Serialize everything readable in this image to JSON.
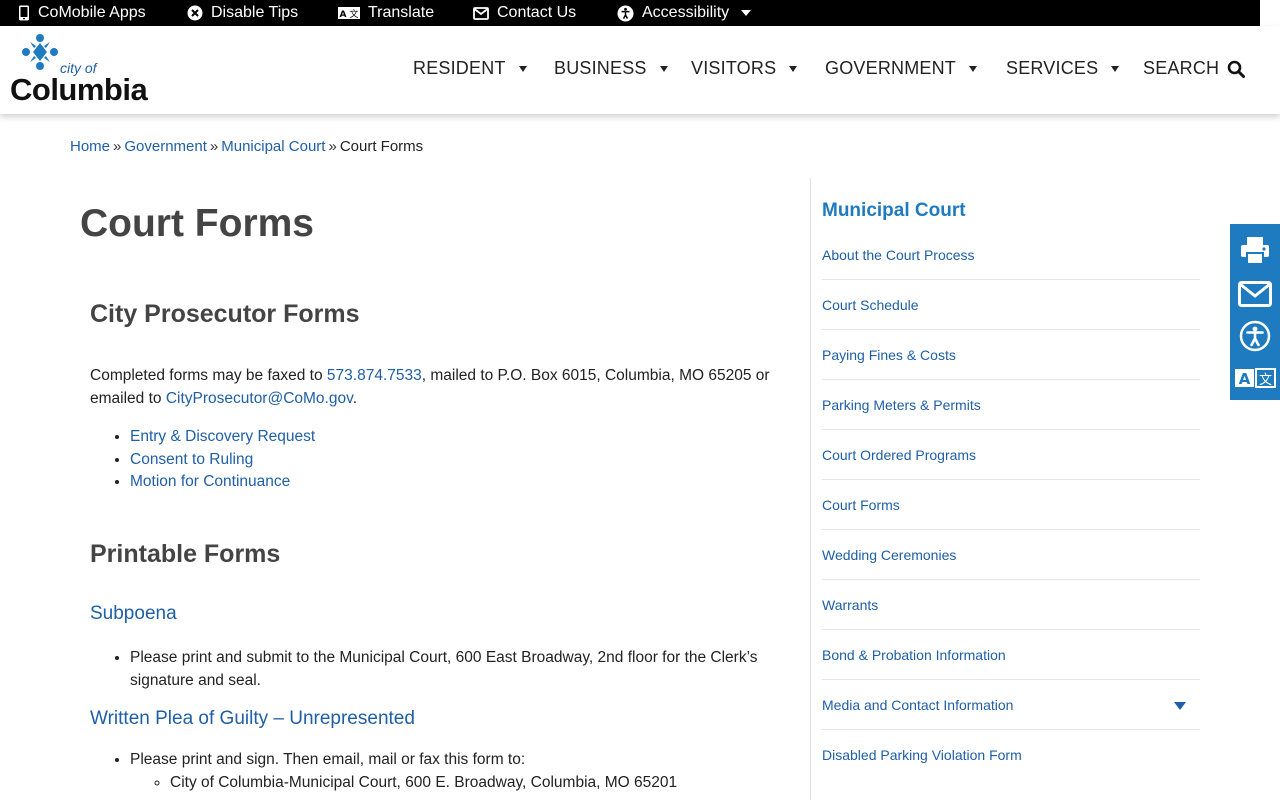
{
  "topbar": {
    "items": [
      {
        "label": "CoMobile Apps",
        "icon": "phone-icon"
      },
      {
        "label": "Disable Tips",
        "icon": "close-circle-icon"
      },
      {
        "label": "Translate",
        "icon": "translate-icon"
      },
      {
        "label": "Contact Us",
        "icon": "envelope-icon"
      },
      {
        "label": "Accessibility",
        "icon": "accessibility-icon"
      }
    ]
  },
  "logo": {
    "small": "city of",
    "name": "Columbia"
  },
  "nav": {
    "items": [
      {
        "label": "RESIDENT"
      },
      {
        "label": "BUSINESS"
      },
      {
        "label": "VISITORS"
      },
      {
        "label": "GOVERNMENT"
      },
      {
        "label": "SERVICES"
      }
    ],
    "search_label": "SEARCH"
  },
  "breadcrumb": {
    "home": "Home",
    "government": "Government",
    "court": "Municipal Court",
    "current": "Court Forms",
    "sep": "»"
  },
  "main": {
    "title": "Court Forms",
    "prosecutor": {
      "heading": "City Prosecutor Forms",
      "text_1": "Completed forms may be faxed to ",
      "fax": "573.874.7533",
      "text_2": ", mailed to P.O. Box 6015, Columbia, MO 65205 or emailed to ",
      "email": "CityProsecutor@CoMo.gov",
      "text_3": ".",
      "links": [
        "Entry & Discovery Request",
        "Consent to Ruling",
        "Motion for Continuance"
      ]
    },
    "printable": {
      "heading": "Printable Forms",
      "subpoena": {
        "heading": "Subpoena",
        "bullet": "Please print and submit to the Municipal Court, 600 East Broadway, 2nd floor for the Clerk’s signature and seal."
      },
      "plea": {
        "heading": "Written Plea of Guilty – Unrepresented",
        "bullet": "Please print and sign. Then email, mail or fax this form to:",
        "sub_bullet": "City of Columbia-Municipal Court, 600 E. Broadway, Columbia, MO 65201"
      }
    }
  },
  "sidebar": {
    "title": "Municipal Court",
    "items": [
      "About the Court Process",
      "Court Schedule",
      "Paying Fines & Costs",
      "Parking Meters & Permits",
      "Court Ordered Programs",
      "Court Forms",
      "Wedding Ceremonies",
      "Warrants",
      "Bond & Probation Information",
      "Media and Contact Information",
      "Disabled Parking Violation Form"
    ]
  },
  "float_tools": [
    "print-icon",
    "email-icon",
    "accessibility-icon",
    "translate-icon"
  ],
  "colors": {
    "link": "#1f5fa6",
    "accent": "#1f7bc0",
    "heading": "#444444",
    "topbar": "#000000"
  }
}
